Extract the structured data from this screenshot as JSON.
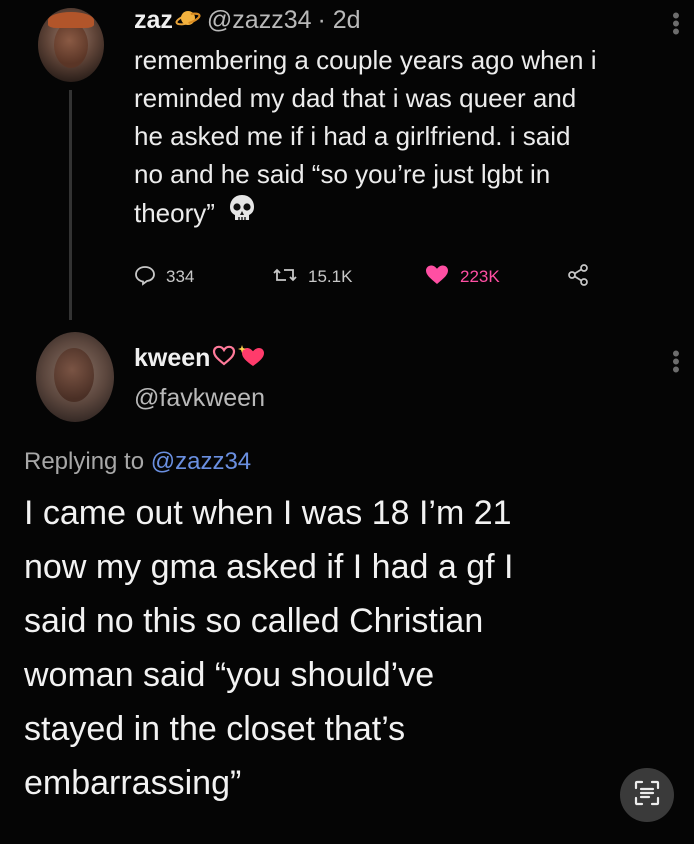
{
  "tweet": {
    "name": "zaz",
    "handle": "@zazz34",
    "time": "· 2d",
    "text_lines": [
      "remembering a couple years ago when i",
      "reminded my dad that i was queer and",
      "he asked me if i had a girlfriend. i said",
      "no and he said “so you’re just lgbt in",
      "theory”"
    ],
    "replies": "334",
    "retweets": "15.1K",
    "likes": "223K",
    "like_color": "#ff4fa3",
    "icons": [
      "planet-emoji-icon",
      "skull-emoji-icon",
      "reply-icon",
      "retweet-icon",
      "heart-icon",
      "share-icon",
      "more-options-icon"
    ]
  },
  "reply": {
    "name": "kween",
    "handle": "@favkween",
    "replying_prefix": "Replying to",
    "replying_to": "@zazz34",
    "text_lines": [
      "I came out when I was 18 I’m 21",
      "now my gma asked if I had a gf I",
      "said no this so called Christian",
      "woman said “you should’ve",
      "stayed in the closet that’s",
      "embarrassing”"
    ],
    "icons": [
      "heart-emoji-icon",
      "sparkling-heart-emoji-icon",
      "more-options-icon"
    ]
  },
  "overlay": {
    "icons": [
      "text-scan-icon"
    ]
  }
}
